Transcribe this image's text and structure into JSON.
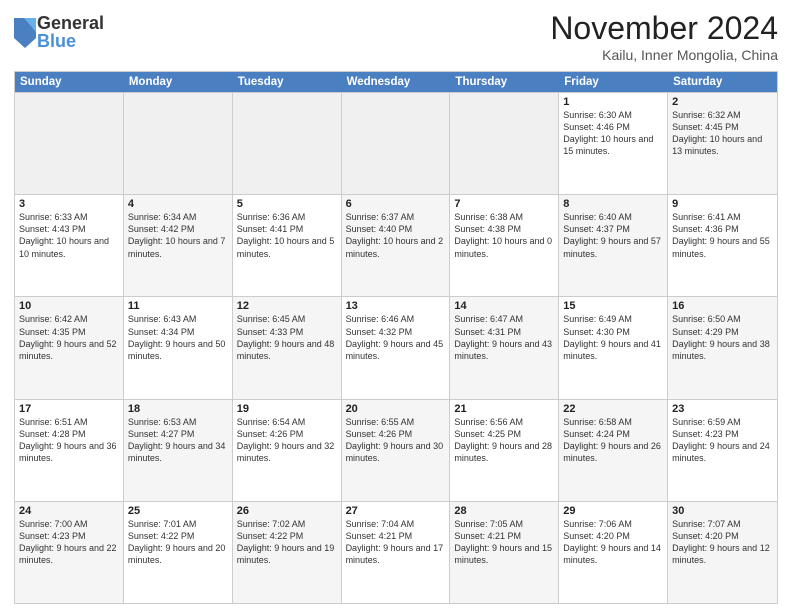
{
  "logo": {
    "general": "General",
    "blue": "Blue"
  },
  "title": "November 2024",
  "location": "Kailu, Inner Mongolia, China",
  "days_header": [
    "Sunday",
    "Monday",
    "Tuesday",
    "Wednesday",
    "Thursday",
    "Friday",
    "Saturday"
  ],
  "weeks": [
    [
      {
        "day": "",
        "info": "",
        "empty": true
      },
      {
        "day": "",
        "info": "",
        "empty": true
      },
      {
        "day": "",
        "info": "",
        "empty": true
      },
      {
        "day": "",
        "info": "",
        "empty": true
      },
      {
        "day": "",
        "info": "",
        "empty": true
      },
      {
        "day": "1",
        "info": "Sunrise: 6:30 AM\nSunset: 4:46 PM\nDaylight: 10 hours and 15 minutes.",
        "empty": false
      },
      {
        "day": "2",
        "info": "Sunrise: 6:32 AM\nSunset: 4:45 PM\nDaylight: 10 hours and 13 minutes.",
        "empty": false,
        "shaded": true
      }
    ],
    [
      {
        "day": "3",
        "info": "Sunrise: 6:33 AM\nSunset: 4:43 PM\nDaylight: 10 hours and 10 minutes.",
        "empty": false
      },
      {
        "day": "4",
        "info": "Sunrise: 6:34 AM\nSunset: 4:42 PM\nDaylight: 10 hours and 7 minutes.",
        "empty": false,
        "shaded": true
      },
      {
        "day": "5",
        "info": "Sunrise: 6:36 AM\nSunset: 4:41 PM\nDaylight: 10 hours and 5 minutes.",
        "empty": false
      },
      {
        "day": "6",
        "info": "Sunrise: 6:37 AM\nSunset: 4:40 PM\nDaylight: 10 hours and 2 minutes.",
        "empty": false,
        "shaded": true
      },
      {
        "day": "7",
        "info": "Sunrise: 6:38 AM\nSunset: 4:38 PM\nDaylight: 10 hours and 0 minutes.",
        "empty": false
      },
      {
        "day": "8",
        "info": "Sunrise: 6:40 AM\nSunset: 4:37 PM\nDaylight: 9 hours and 57 minutes.",
        "empty": false,
        "shaded": true
      },
      {
        "day": "9",
        "info": "Sunrise: 6:41 AM\nSunset: 4:36 PM\nDaylight: 9 hours and 55 minutes.",
        "empty": false
      }
    ],
    [
      {
        "day": "10",
        "info": "Sunrise: 6:42 AM\nSunset: 4:35 PM\nDaylight: 9 hours and 52 minutes.",
        "empty": false,
        "shaded": true
      },
      {
        "day": "11",
        "info": "Sunrise: 6:43 AM\nSunset: 4:34 PM\nDaylight: 9 hours and 50 minutes.",
        "empty": false
      },
      {
        "day": "12",
        "info": "Sunrise: 6:45 AM\nSunset: 4:33 PM\nDaylight: 9 hours and 48 minutes.",
        "empty": false,
        "shaded": true
      },
      {
        "day": "13",
        "info": "Sunrise: 6:46 AM\nSunset: 4:32 PM\nDaylight: 9 hours and 45 minutes.",
        "empty": false
      },
      {
        "day": "14",
        "info": "Sunrise: 6:47 AM\nSunset: 4:31 PM\nDaylight: 9 hours and 43 minutes.",
        "empty": false,
        "shaded": true
      },
      {
        "day": "15",
        "info": "Sunrise: 6:49 AM\nSunset: 4:30 PM\nDaylight: 9 hours and 41 minutes.",
        "empty": false
      },
      {
        "day": "16",
        "info": "Sunrise: 6:50 AM\nSunset: 4:29 PM\nDaylight: 9 hours and 38 minutes.",
        "empty": false,
        "shaded": true
      }
    ],
    [
      {
        "day": "17",
        "info": "Sunrise: 6:51 AM\nSunset: 4:28 PM\nDaylight: 9 hours and 36 minutes.",
        "empty": false
      },
      {
        "day": "18",
        "info": "Sunrise: 6:53 AM\nSunset: 4:27 PM\nDaylight: 9 hours and 34 minutes.",
        "empty": false,
        "shaded": true
      },
      {
        "day": "19",
        "info": "Sunrise: 6:54 AM\nSunset: 4:26 PM\nDaylight: 9 hours and 32 minutes.",
        "empty": false
      },
      {
        "day": "20",
        "info": "Sunrise: 6:55 AM\nSunset: 4:26 PM\nDaylight: 9 hours and 30 minutes.",
        "empty": false,
        "shaded": true
      },
      {
        "day": "21",
        "info": "Sunrise: 6:56 AM\nSunset: 4:25 PM\nDaylight: 9 hours and 28 minutes.",
        "empty": false
      },
      {
        "day": "22",
        "info": "Sunrise: 6:58 AM\nSunset: 4:24 PM\nDaylight: 9 hours and 26 minutes.",
        "empty": false,
        "shaded": true
      },
      {
        "day": "23",
        "info": "Sunrise: 6:59 AM\nSunset: 4:23 PM\nDaylight: 9 hours and 24 minutes.",
        "empty": false
      }
    ],
    [
      {
        "day": "24",
        "info": "Sunrise: 7:00 AM\nSunset: 4:23 PM\nDaylight: 9 hours and 22 minutes.",
        "empty": false,
        "shaded": true
      },
      {
        "day": "25",
        "info": "Sunrise: 7:01 AM\nSunset: 4:22 PM\nDaylight: 9 hours and 20 minutes.",
        "empty": false
      },
      {
        "day": "26",
        "info": "Sunrise: 7:02 AM\nSunset: 4:22 PM\nDaylight: 9 hours and 19 minutes.",
        "empty": false,
        "shaded": true
      },
      {
        "day": "27",
        "info": "Sunrise: 7:04 AM\nSunset: 4:21 PM\nDaylight: 9 hours and 17 minutes.",
        "empty": false
      },
      {
        "day": "28",
        "info": "Sunrise: 7:05 AM\nSunset: 4:21 PM\nDaylight: 9 hours and 15 minutes.",
        "empty": false,
        "shaded": true
      },
      {
        "day": "29",
        "info": "Sunrise: 7:06 AM\nSunset: 4:20 PM\nDaylight: 9 hours and 14 minutes.",
        "empty": false
      },
      {
        "day": "30",
        "info": "Sunrise: 7:07 AM\nSunset: 4:20 PM\nDaylight: 9 hours and 12 minutes.",
        "empty": false,
        "shaded": true
      }
    ]
  ]
}
